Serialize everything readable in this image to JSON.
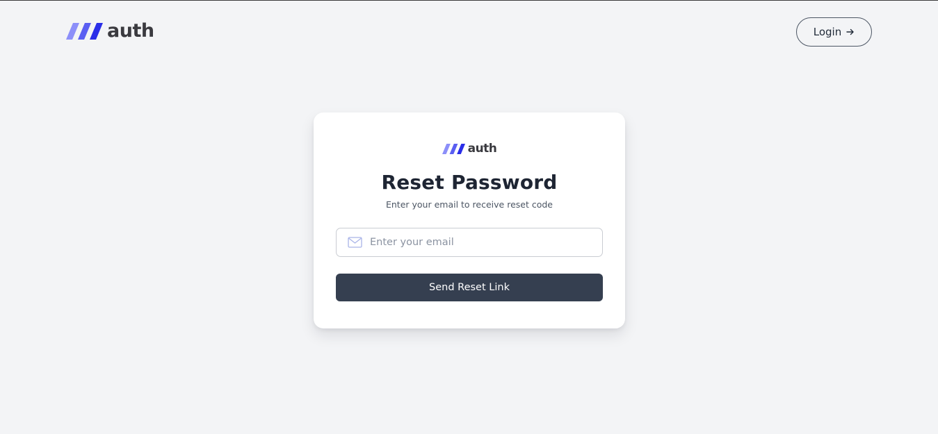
{
  "header": {
    "brand": {
      "logo_icon": "slanted-bars-logo-icon",
      "name": "auth"
    },
    "login_button": {
      "label": "Login",
      "icon": "arrow-right-icon"
    }
  },
  "reset_card": {
    "brand": {
      "logo_icon": "slanted-bars-logo-icon",
      "name": "auth"
    },
    "title": "Reset Password",
    "subtitle": "Enter your email to receive reset code",
    "email_field": {
      "icon": "mail-icon",
      "value": "",
      "placeholder": "Enter your email"
    },
    "submit_label": "Send Reset Link"
  },
  "colors": {
    "page_background": "#f3f4f6",
    "card_background": "#ffffff",
    "primary_button": "#353f50",
    "logo_gradient": [
      "#8b8ff8",
      "#2b2fe8"
    ],
    "title_text": "#1e2533"
  }
}
